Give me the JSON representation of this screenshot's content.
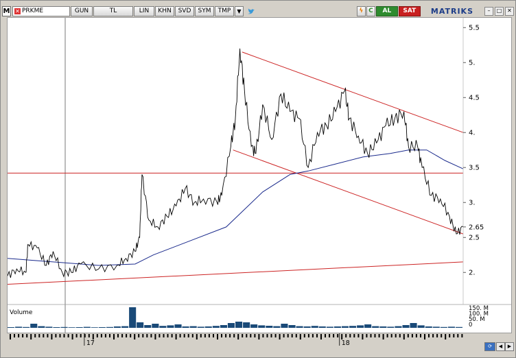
{
  "toolbar": {
    "logo": "M",
    "symbol": "PRKME",
    "buttons": [
      "GUN",
      "TL",
      "LIN",
      "KHN",
      "SVD",
      "SYM",
      "TMP"
    ],
    "buy_label": "AL",
    "sell_label": "SAT",
    "brand": "MATRIKS"
  },
  "chart_data": {
    "type": "line",
    "title": "",
    "xlabel": "",
    "ylabel": "",
    "ylim": [
      1.6,
      5.6
    ],
    "y_ticks": [
      "5.5",
      "5.",
      "4.5",
      "4.",
      "3.5",
      "3.",
      "2.65",
      "2.5",
      "2."
    ],
    "x_tick_labels": [
      "17",
      "18"
    ],
    "last_price": 2.65,
    "price_series": [
      {
        "t": 0.0,
        "v": 1.95
      },
      {
        "t": 0.02,
        "v": 2.05
      },
      {
        "t": 0.04,
        "v": 2.0
      },
      {
        "t": 0.045,
        "v": 2.4
      },
      {
        "t": 0.065,
        "v": 2.35
      },
      {
        "t": 0.085,
        "v": 2.1
      },
      {
        "t": 0.1,
        "v": 2.3
      },
      {
        "t": 0.12,
        "v": 2.0
      },
      {
        "t": 0.14,
        "v": 2.0
      },
      {
        "t": 0.16,
        "v": 2.12
      },
      {
        "t": 0.2,
        "v": 2.05
      },
      {
        "t": 0.24,
        "v": 2.1
      },
      {
        "t": 0.26,
        "v": 2.2
      },
      {
        "t": 0.28,
        "v": 2.3
      },
      {
        "t": 0.29,
        "v": 2.5
      },
      {
        "t": 0.295,
        "v": 3.4
      },
      {
        "t": 0.31,
        "v": 2.75
      },
      {
        "t": 0.33,
        "v": 2.65
      },
      {
        "t": 0.35,
        "v": 2.8
      },
      {
        "t": 0.37,
        "v": 2.95
      },
      {
        "t": 0.39,
        "v": 3.2
      },
      {
        "t": 0.41,
        "v": 3.0
      },
      {
        "t": 0.43,
        "v": 3.05
      },
      {
        "t": 0.46,
        "v": 3.0
      },
      {
        "t": 0.47,
        "v": 3.1
      },
      {
        "t": 0.49,
        "v": 3.8
      },
      {
        "t": 0.5,
        "v": 4.2
      },
      {
        "t": 0.51,
        "v": 5.2
      },
      {
        "t": 0.52,
        "v": 4.6
      },
      {
        "t": 0.535,
        "v": 3.8
      },
      {
        "t": 0.545,
        "v": 3.7
      },
      {
        "t": 0.56,
        "v": 4.4
      },
      {
        "t": 0.58,
        "v": 3.9
      },
      {
        "t": 0.6,
        "v": 4.55
      },
      {
        "t": 0.62,
        "v": 4.3
      },
      {
        "t": 0.64,
        "v": 4.2
      },
      {
        "t": 0.66,
        "v": 3.5
      },
      {
        "t": 0.68,
        "v": 4.0
      },
      {
        "t": 0.7,
        "v": 4.1
      },
      {
        "t": 0.72,
        "v": 4.3
      },
      {
        "t": 0.74,
        "v": 4.6
      },
      {
        "t": 0.75,
        "v": 4.2
      },
      {
        "t": 0.77,
        "v": 3.95
      },
      {
        "t": 0.79,
        "v": 3.7
      },
      {
        "t": 0.81,
        "v": 3.85
      },
      {
        "t": 0.83,
        "v": 4.1
      },
      {
        "t": 0.85,
        "v": 4.2
      },
      {
        "t": 0.87,
        "v": 4.3
      },
      {
        "t": 0.88,
        "v": 3.8
      },
      {
        "t": 0.9,
        "v": 3.8
      },
      {
        "t": 0.91,
        "v": 3.5
      },
      {
        "t": 0.93,
        "v": 3.1
      },
      {
        "t": 0.95,
        "v": 3.05
      },
      {
        "t": 0.97,
        "v": 2.8
      },
      {
        "t": 0.985,
        "v": 2.55
      },
      {
        "t": 1.0,
        "v": 2.65
      }
    ],
    "moving_average": [
      {
        "t": 0.0,
        "v": 2.2
      },
      {
        "t": 0.1,
        "v": 2.15
      },
      {
        "t": 0.2,
        "v": 2.1
      },
      {
        "t": 0.28,
        "v": 2.12
      },
      {
        "t": 0.32,
        "v": 2.25
      },
      {
        "t": 0.4,
        "v": 2.45
      },
      {
        "t": 0.48,
        "v": 2.65
      },
      {
        "t": 0.52,
        "v": 2.9
      },
      {
        "t": 0.56,
        "v": 3.15
      },
      {
        "t": 0.62,
        "v": 3.4
      },
      {
        "t": 0.66,
        "v": 3.45
      },
      {
        "t": 0.72,
        "v": 3.55
      },
      {
        "t": 0.78,
        "v": 3.65
      },
      {
        "t": 0.84,
        "v": 3.7
      },
      {
        "t": 0.88,
        "v": 3.75
      },
      {
        "t": 0.92,
        "v": 3.75
      },
      {
        "t": 0.96,
        "v": 3.6
      },
      {
        "t": 1.0,
        "v": 3.48
      }
    ],
    "trendlines": [
      {
        "from": {
          "t": 0.0,
          "v": 3.42
        },
        "to": {
          "t": 1.0,
          "v": 3.42
        }
      },
      {
        "from": {
          "t": 0.0,
          "v": 1.83
        },
        "to": {
          "t": 1.0,
          "v": 2.15
        }
      },
      {
        "from": {
          "t": 0.515,
          "v": 5.15
        },
        "to": {
          "t": 1.0,
          "v": 4.0
        }
      },
      {
        "from": {
          "t": 0.495,
          "v": 3.75
        },
        "to": {
          "t": 1.0,
          "v": 2.55
        }
      }
    ],
    "volume": {
      "label": "Volume",
      "y_ticks": [
        "150. M",
        "100. M",
        "50. M",
        "0"
      ],
      "ylim": [
        0,
        150
      ],
      "bars": [
        5,
        8,
        6,
        30,
        12,
        8,
        5,
        6,
        4,
        5,
        7,
        4,
        5,
        6,
        10,
        12,
        160,
        40,
        20,
        30,
        14,
        18,
        25,
        10,
        12,
        8,
        10,
        14,
        20,
        35,
        45,
        40,
        25,
        18,
        15,
        12,
        30,
        20,
        12,
        10,
        14,
        10,
        8,
        10,
        12,
        14,
        18,
        25,
        12,
        10,
        8,
        12,
        20,
        35,
        18,
        10,
        8,
        6,
        8,
        6
      ]
    }
  },
  "colors": {
    "price": "#000000",
    "moving_average": "#1a2a8c",
    "trendline": "#cc2222",
    "volume": "#1a4a78",
    "buy": "#2e8b2e",
    "sell": "#c82020"
  }
}
